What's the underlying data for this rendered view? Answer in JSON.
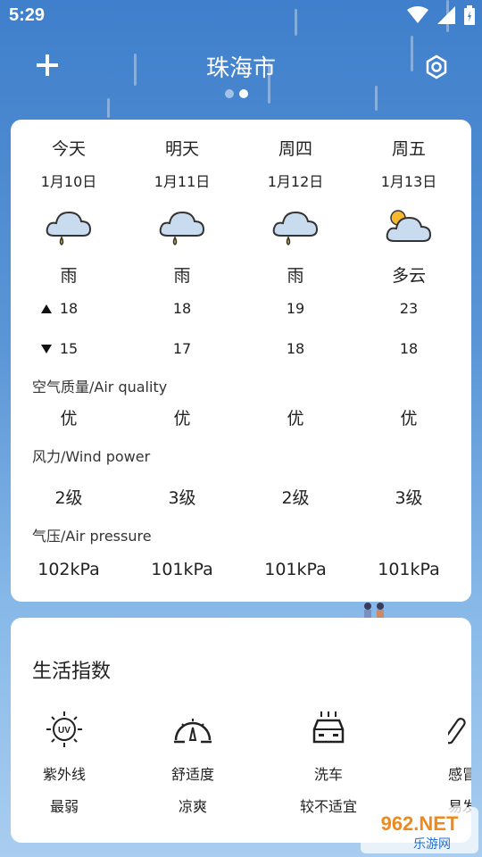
{
  "status": {
    "time": "5:29"
  },
  "header": {
    "city": "珠海市"
  },
  "forecast": [
    {
      "day": "今天",
      "date": "1月10日",
      "icon": "rain-cloud-icon",
      "condition": "雨",
      "high": "18",
      "low": "15",
      "air": "优",
      "wind": "2级",
      "pressure": "102kPa"
    },
    {
      "day": "明天",
      "date": "1月11日",
      "icon": "rain-cloud-icon",
      "condition": "雨",
      "high": "18",
      "low": "17",
      "air": "优",
      "wind": "3级",
      "pressure": "101kPa"
    },
    {
      "day": "周四",
      "date": "1月12日",
      "icon": "rain-cloud-icon",
      "condition": "雨",
      "high": "19",
      "low": "18",
      "air": "优",
      "wind": "2级",
      "pressure": "101kPa"
    },
    {
      "day": "周五",
      "date": "1月13日",
      "icon": "partly-cloudy-icon",
      "condition": "多云",
      "high": "23",
      "low": "18",
      "air": "优",
      "wind": "3级",
      "pressure": "101kPa"
    }
  ],
  "labels": {
    "air_quality": "空气质量/Air quality",
    "wind_power": "风力/Wind power",
    "air_pressure": "气压/Air pressure"
  },
  "life": {
    "title": "生活指数",
    "items": [
      {
        "icon": "uv-icon",
        "name": "紫外线",
        "value": "最弱"
      },
      {
        "icon": "gauge-icon",
        "name": "舒适度",
        "value": "凉爽"
      },
      {
        "icon": "car-wash-icon",
        "name": "洗车",
        "value": "较不适宜"
      },
      {
        "icon": "thermometer-icon",
        "name": "感冒",
        "value": "易发"
      }
    ]
  },
  "watermark": {
    "text": "962.NET",
    "subtext": "乐游网"
  },
  "colors": {
    "accent": "#3f7fcb",
    "sun": "#f5b82e",
    "drop": "#e8b81a"
  }
}
